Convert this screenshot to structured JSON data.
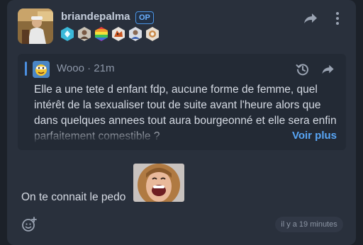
{
  "post": {
    "username": "briandepalma",
    "op_badge": "OP",
    "badge_icons": [
      "diamond-badge-icon",
      "portrait-badge-icon",
      "rainbow-badge-icon",
      "wolf-badge-icon",
      "shield-badge-icon",
      "clock-badge-icon"
    ],
    "message": "On te connait le pedo",
    "timestamp": "il y a 19 minutes"
  },
  "quote": {
    "author": "Wooo",
    "separator": "·",
    "time": "21m",
    "text": "Elle a une tete d enfant fdp, aucune forme de femme, quel intérêt de la sexualiser tout de suite avant l'heure alors que dans quelques annees tout aura bourgeonné et elle sera enfin parfaitement comestible ?",
    "see_more": "Voir plus"
  },
  "colors": {
    "background": "#1c2129",
    "card": "#29303c",
    "quote_bg": "#232a35",
    "accent": "#58a6f6",
    "op_border": "#4a94e4"
  }
}
